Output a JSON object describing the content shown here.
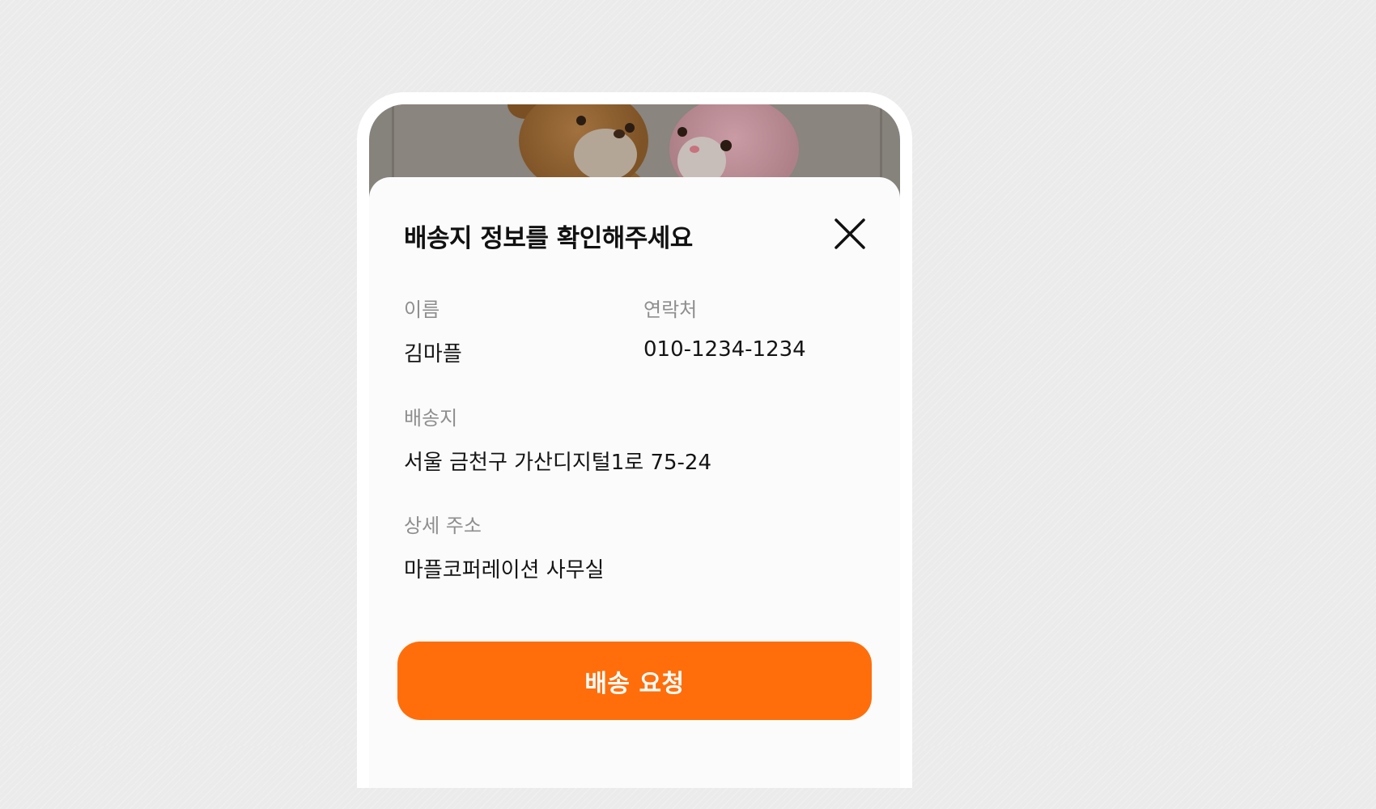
{
  "sheet": {
    "title": "배송지 정보를 확인해주세요",
    "close_icon": "close-icon"
  },
  "fields": {
    "name": {
      "label": "이름",
      "value": "김마플"
    },
    "phone": {
      "label": "연락처",
      "value": "010-1234-1234"
    },
    "address": {
      "label": "배송지",
      "value": "서울 금천구 가산디지털1로 75-24"
    },
    "address_detail": {
      "label": "상세 주소",
      "value": "마플코퍼레이션 사무실"
    }
  },
  "submit_button": {
    "label": "배송 요청"
  },
  "colors": {
    "accent": "#ff6e0a",
    "label": "#8e8e8e",
    "text": "#141414",
    "page_background": "#ebebeb",
    "sheet_background": "#fbfbfb"
  }
}
